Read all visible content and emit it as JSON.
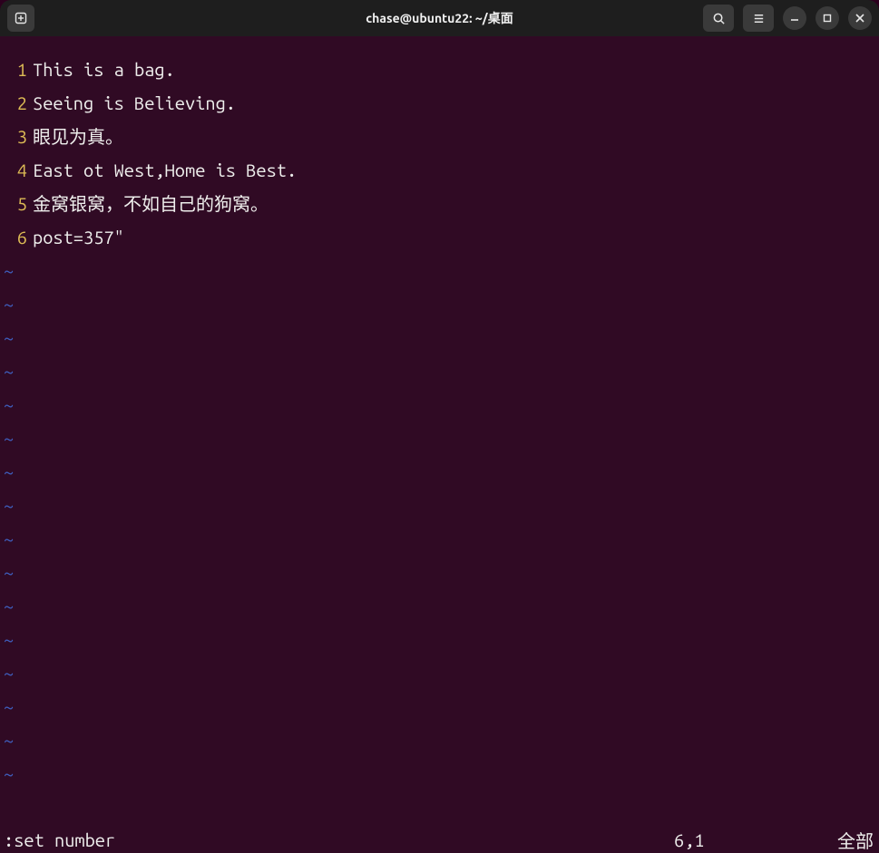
{
  "titlebar": {
    "title": "chase@ubuntu22: ~/桌面"
  },
  "editor": {
    "lines": [
      {
        "num": "1",
        "text": "This is a bag."
      },
      {
        "num": "2",
        "text": "Seeing is Believing."
      },
      {
        "num": "3",
        "text": "眼见为真。"
      },
      {
        "num": "4",
        "text": "East ot West,Home is Best."
      },
      {
        "num": "5",
        "text": "金窝银窝，不如自己的狗窝。"
      },
      {
        "num": "6",
        "text": "post=357\""
      }
    ],
    "tilde": "~",
    "tilde_count": 16
  },
  "status": {
    "command": ":set number",
    "position": "6,1",
    "percent": "全部"
  }
}
